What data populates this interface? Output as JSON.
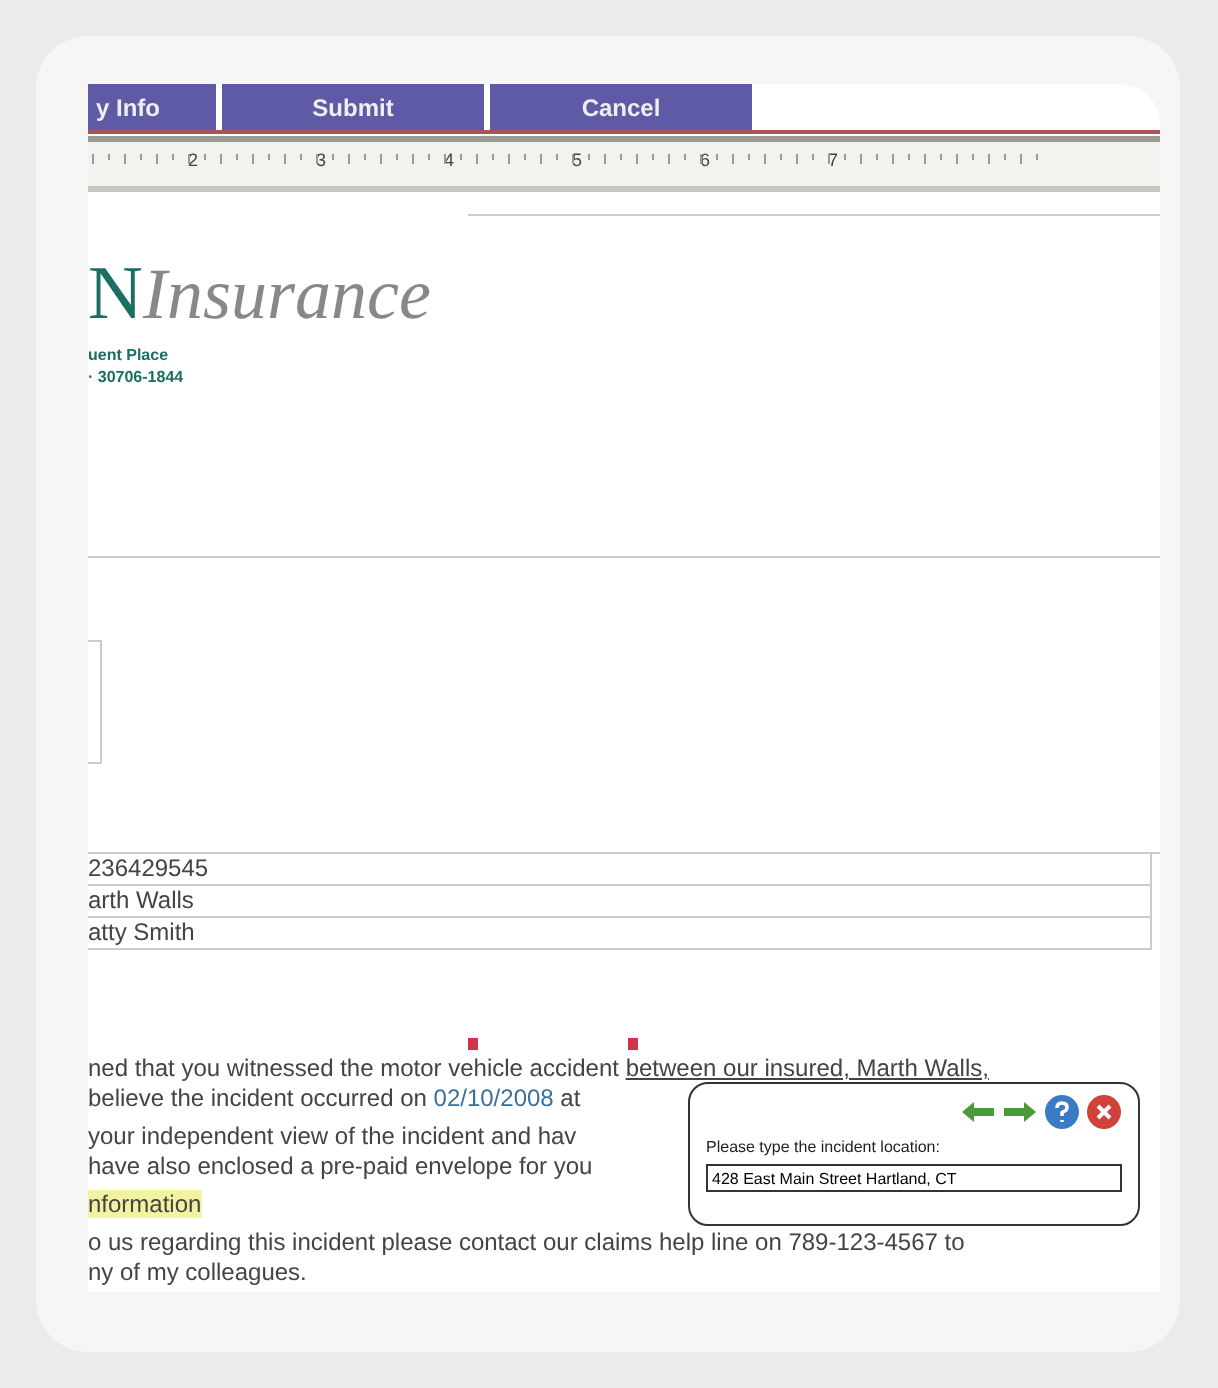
{
  "tabs": [
    {
      "label": "y Info"
    },
    {
      "label": "Submit"
    },
    {
      "label": "Cancel"
    }
  ],
  "ruler": {
    "numbers": [
      "2",
      "3",
      "4",
      "5",
      "6",
      "7"
    ]
  },
  "logo": {
    "initial": "N",
    "word": "Insurance",
    "address_lines": [
      "uent Place",
      "· 30706-1844"
    ]
  },
  "fields": [
    "236429545",
    "arth Walls",
    "atty Smith"
  ],
  "letter": {
    "line_1": "ned that you witnessed the motor vehicle accident ",
    "line_1_underlined": "between our insured, Marth Walls,",
    "line_2": "believe the incident occurred on ",
    "date": "02/10/2008",
    "line_2_end": " at",
    "line_3": "your independent view of the incident and hav",
    "line_4": "have also enclosed a pre-paid envelope for you",
    "highlighted": "nformation",
    "line_5": "o us regarding this incident please contact our claims help line on 789-123-4567 to",
    "line_6": "ny of my colleagues."
  },
  "popup": {
    "prompt": "Please type the incident location:",
    "value": "428 East Main Street Hartland, CT"
  }
}
